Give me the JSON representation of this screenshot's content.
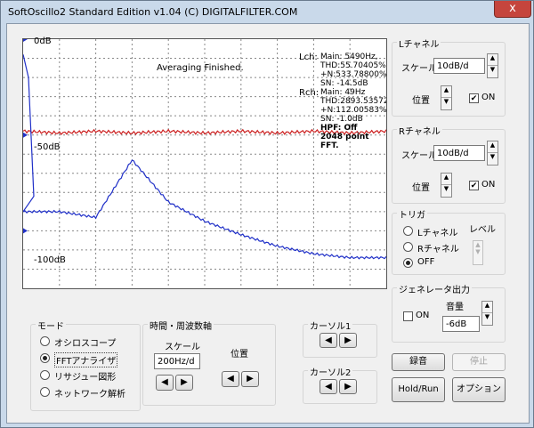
{
  "window": {
    "title": "SoftOscillo2 Standard Edition v1.04 (C) DIGITALFILTER.COM",
    "close_glyph": "x"
  },
  "plot": {
    "y_labels": [
      "0dB",
      "-50dB",
      "-100dB"
    ],
    "status": "Averaging Finished.",
    "lch_label": "Lch:",
    "lch_lines": [
      "Main: 5490Hz,",
      "THD:55.70405%",
      "+N:533.78800%",
      "SN: -14.5dB"
    ],
    "rch_label": "Rch:",
    "rch_lines": [
      "Main: 49Hz",
      "THD:2893.53572",
      "+N:112.00583%",
      "SN: -1.0dB"
    ],
    "hpf": "HPF: Off",
    "fft_points": "2048 point FFT.",
    "colors": {
      "red": "#cc2020",
      "blue": "#2030c8"
    }
  },
  "lch": {
    "title": "Lチャネル",
    "scale_label": "スケール",
    "scale_value": "10dB/d",
    "pos_label": "位置",
    "on_label": "ON",
    "on_checked": "✔"
  },
  "rch": {
    "title": "Rチャネル",
    "scale_label": "スケール",
    "scale_value": "10dB/d",
    "pos_label": "位置",
    "on_label": "ON",
    "on_checked": "✔"
  },
  "trigger": {
    "title": "トリガ",
    "options": [
      "Lチャネル",
      "Rチャネル",
      "OFF"
    ],
    "selected": "OFF",
    "level_label": "レベル"
  },
  "generator": {
    "title": "ジェネレータ出力",
    "on_label": "ON",
    "volume_label": "音量",
    "volume_value": "-6dB"
  },
  "mode": {
    "title": "モード",
    "options": [
      "オシロスコープ",
      "FFTアナライザ",
      "リサジュー図形",
      "ネットワーク解析"
    ],
    "selected": "FFTアナライザ"
  },
  "timefreq": {
    "title": "時間・周波数軸",
    "scale_label": "スケール",
    "scale_value": "200Hz/d",
    "pos_label": "位置"
  },
  "cursor1": {
    "title": "カーソル1"
  },
  "cursor2": {
    "title": "カーソル2"
  },
  "arrows": {
    "left": "◀",
    "right": "▶",
    "up": "▲",
    "down": "▼"
  },
  "buttons": {
    "record": "録音",
    "stop": "停止",
    "holdrun": "Hold/Run",
    "options": "オプション"
  },
  "chart_data": {
    "type": "line",
    "ylim": [
      -130,
      0
    ],
    "y_ticks": [
      0,
      -50,
      -100
    ],
    "x": [
      0,
      1,
      2,
      3,
      4,
      5,
      6,
      7,
      8,
      9,
      10
    ],
    "series": [
      {
        "color": "#cc2020",
        "values": [
          -48,
          -49,
          -48,
          -49,
          -48,
          -49,
          -48,
          -49,
          -48,
          -49,
          -48
        ]
      },
      {
        "color": "#2030c8",
        "values": [
          -90,
          -90,
          -93,
          -63,
          -85,
          -95,
          -102,
          -108,
          -112,
          -114,
          -114
        ]
      }
    ]
  }
}
